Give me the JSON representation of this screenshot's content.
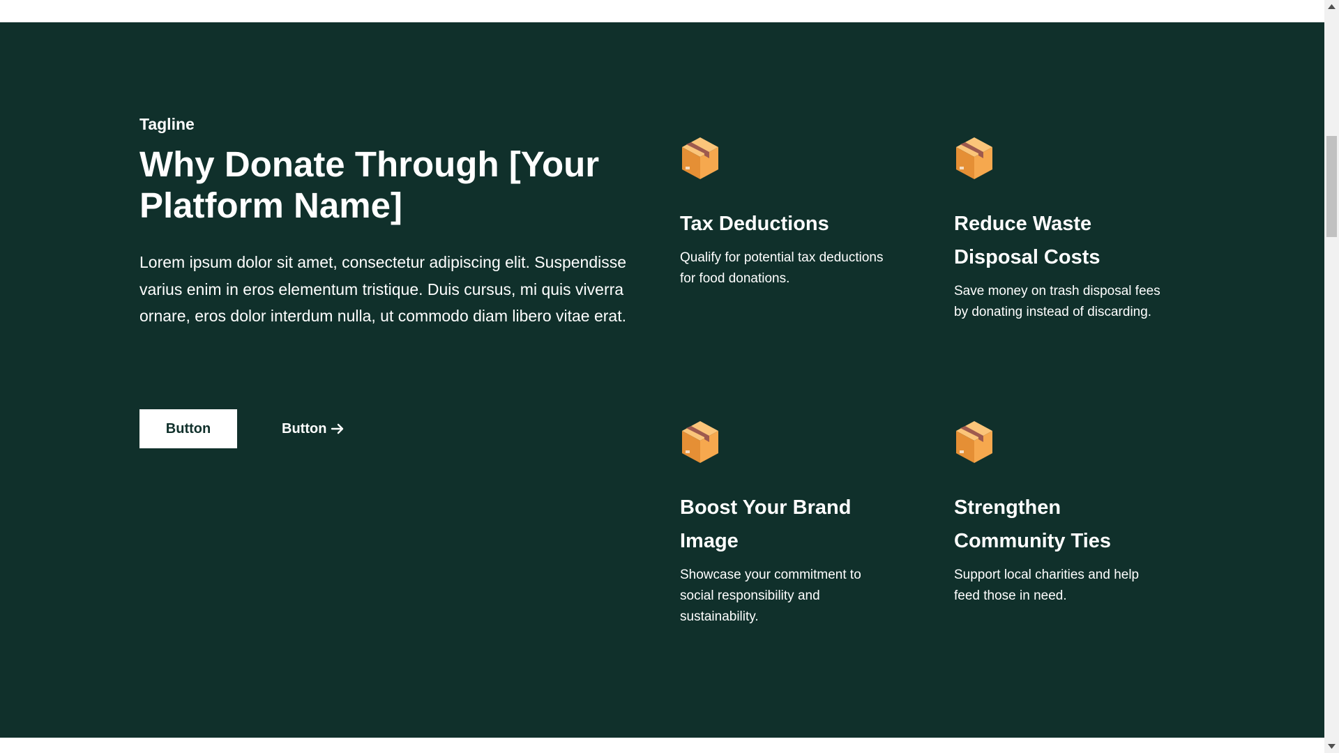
{
  "section": {
    "tagline": "Tagline",
    "heading": "Why Donate Through [Your Platform Name]",
    "body": "Lorem ipsum dolor sit amet, consectetur adipiscing elit. Suspendisse varius enim in eros elementum tristique. Duis cursus, mi quis viverra ornare, eros dolor interdum nulla, ut commodo diam libero vitae erat.",
    "primary_button": "Button",
    "secondary_button": "Button",
    "secondary_icon": "arrow-right-icon"
  },
  "features": [
    {
      "icon": "package-icon",
      "title": "Tax Deductions",
      "description": "Qualify for potential tax deductions for food donations."
    },
    {
      "icon": "package-icon",
      "title": "Reduce Waste Disposal Costs",
      "description": "Save money on trash disposal fees by donating instead of discarding."
    },
    {
      "icon": "package-icon",
      "title": "Boost Your Brand Image",
      "description": "Showcase your commitment to social responsibility and sustainability."
    },
    {
      "icon": "package-icon",
      "title": "Strengthen Community Ties",
      "description": "Support local charities and help feed those in need."
    }
  ],
  "colors": {
    "background": "#10302b",
    "text": "#ffffff",
    "button_bg": "#ffffff",
    "button_text": "#10302b",
    "icon_box": "#f4a54a"
  }
}
